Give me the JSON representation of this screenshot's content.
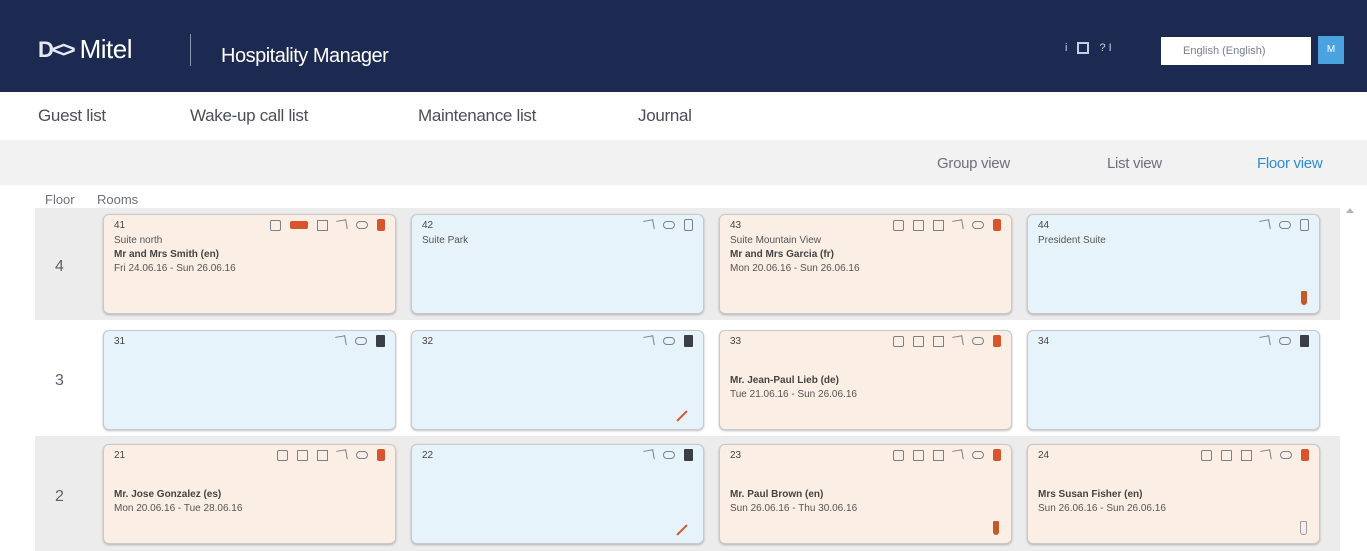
{
  "header": {
    "brand_mark": "D<>",
    "brand_name": "Mitel",
    "app_title": "Hospitality Manager",
    "icons": [
      "info-icon",
      "window-icon",
      "help-icon"
    ],
    "language": "English (English)",
    "user_initials": "M"
  },
  "nav": {
    "items": [
      "Guest list",
      "Wake-up call list",
      "Maintenance list",
      "Journal"
    ]
  },
  "views": {
    "items": [
      "Group view",
      "List view",
      "Floor view"
    ],
    "active": "Floor view"
  },
  "table": {
    "floor_header": "Floor",
    "rooms_header": "Rooms"
  },
  "floors": [
    {
      "number": "4",
      "rooms": [
        {
          "number": "41",
          "state": "occupied",
          "line1": "Suite north",
          "line2": "Mr and Mrs Smith (en)",
          "line3": "Fri 24.06.16 - Sun 26.06.16"
        },
        {
          "number": "42",
          "state": "vacant",
          "line1": "Suite Park",
          "line2": "",
          "line3": ""
        },
        {
          "number": "43",
          "state": "occupied",
          "line1": "Suite Mountain View",
          "line2": "Mr and Mrs Garcia (fr)",
          "line3": "Mon 20.06.16 - Sun 26.06.16"
        },
        {
          "number": "44",
          "state": "vacant",
          "line1": "President Suite",
          "line2": "",
          "line3": ""
        }
      ]
    },
    {
      "number": "3",
      "rooms": [
        {
          "number": "31",
          "state": "vacant",
          "line1": "",
          "line2": "",
          "line3": ""
        },
        {
          "number": "32",
          "state": "vacant",
          "line1": "",
          "line2": "",
          "line3": ""
        },
        {
          "number": "33",
          "state": "occupied",
          "line1": "",
          "line2": "Mr. Jean-Paul Lieb (de)",
          "line3": "Tue 21.06.16 - Sun 26.06.16"
        },
        {
          "number": "34",
          "state": "vacant",
          "line1": "",
          "line2": "",
          "line3": ""
        }
      ]
    },
    {
      "number": "2",
      "rooms": [
        {
          "number": "21",
          "state": "occupied",
          "line1": "",
          "line2": "Mr. Jose Gonzalez (es)",
          "line3": "Mon 20.06.16 - Tue 28.06.16"
        },
        {
          "number": "22",
          "state": "vacant",
          "line1": "",
          "line2": "",
          "line3": ""
        },
        {
          "number": "23",
          "state": "occupied",
          "line1": "",
          "line2": "Mr. Paul Brown (en)",
          "line3": "Sun 26.06.16 - Thu 30.06.16"
        },
        {
          "number": "24",
          "state": "occupied",
          "line1": "",
          "line2": "Mrs Susan Fisher (en)",
          "line3": "Sun 26.06.16 - Sun 26.06.16"
        }
      ]
    }
  ],
  "colors": {
    "header_bg": "#1c2a52",
    "accent": "#2d8dd2",
    "occupied_bg": "#fbeee5",
    "vacant_bg": "#e7f3fb",
    "alert": "#d8542c"
  }
}
